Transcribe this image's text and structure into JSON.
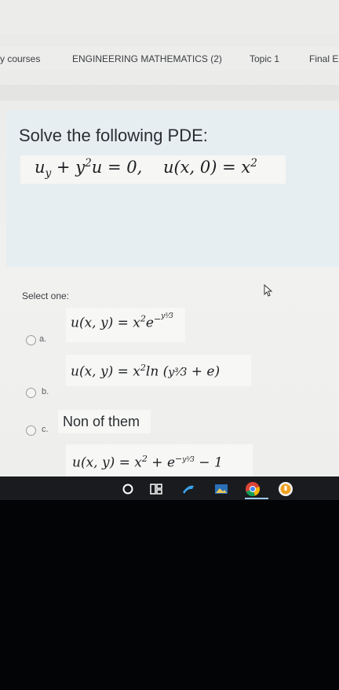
{
  "breadcrumb": {
    "items": [
      "y courses",
      "ENGINEERING MATHEMATICS (2)",
      "Topic 1",
      "Final E"
    ]
  },
  "question": {
    "title": "Solve the following PDE:",
    "equation": "u_y + y²u = 0,    u(x,0) = x²"
  },
  "answers": {
    "prompt": "Select one:",
    "options": [
      {
        "letter": "a.",
        "text": "u(x,y) = x²e^(−y³/3)"
      },
      {
        "letter": "b.",
        "text": "u(x,y) = x² ln(y³/3 + e)"
      },
      {
        "letter": "c.",
        "text": "Non of them"
      },
      {
        "letter": "",
        "text": "u(x,y) = x² + e^(−y³/3) − 1"
      }
    ]
  },
  "taskbar": {
    "icons": [
      "circle-icon",
      "task-view-icon",
      "pen-icon",
      "photos-icon",
      "chrome-icon",
      "vpn-icon"
    ]
  },
  "colors": {
    "question_bg": "#e7eef2",
    "option_bg": "#f7f7f5",
    "taskbar": "#1a1b1e"
  }
}
